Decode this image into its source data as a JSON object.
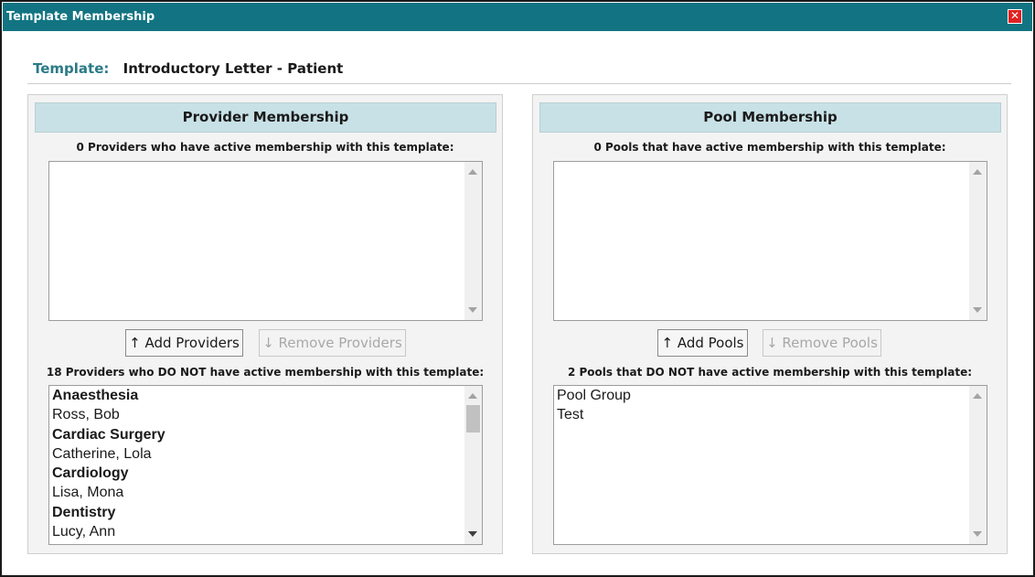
{
  "dialog": {
    "title": "Template Membership",
    "close_glyph": "✕"
  },
  "template": {
    "label": "Template:",
    "value": "Introductory Letter - Patient"
  },
  "provider": {
    "heading": "Provider Membership",
    "active_caption": "0 Providers who have active membership with this template:",
    "active_items": [],
    "add_label": "↑ Add Providers",
    "remove_label": "↓ Remove Providers",
    "inactive_caption": "18 Providers who DO NOT have active membership with this template:",
    "inactive_items": [
      {
        "text": "Anaesthesia",
        "group": true
      },
      {
        "text": "Ross, Bob",
        "group": false
      },
      {
        "text": "Cardiac Surgery",
        "group": true
      },
      {
        "text": "Catherine, Lola",
        "group": false
      },
      {
        "text": "Cardiology",
        "group": true
      },
      {
        "text": "Lisa, Mona",
        "group": false
      },
      {
        "text": "Dentistry",
        "group": true
      },
      {
        "text": "Lucy, Ann",
        "group": false
      }
    ]
  },
  "pool": {
    "heading": "Pool Membership",
    "active_caption": "0 Pools that have active membership with this template:",
    "active_items": [],
    "add_label": "↑ Add Pools",
    "remove_label": "↓ Remove Pools",
    "inactive_caption": "2 Pools that DO NOT have active membership with this template:",
    "inactive_items": [
      {
        "text": "Pool Group",
        "group": false
      },
      {
        "text": "Test",
        "group": false
      }
    ]
  },
  "colors": {
    "titlebar": "#127482",
    "panel_header": "#c8e1e6",
    "template_label": "#2a7b86",
    "close_button": "#e02121"
  }
}
